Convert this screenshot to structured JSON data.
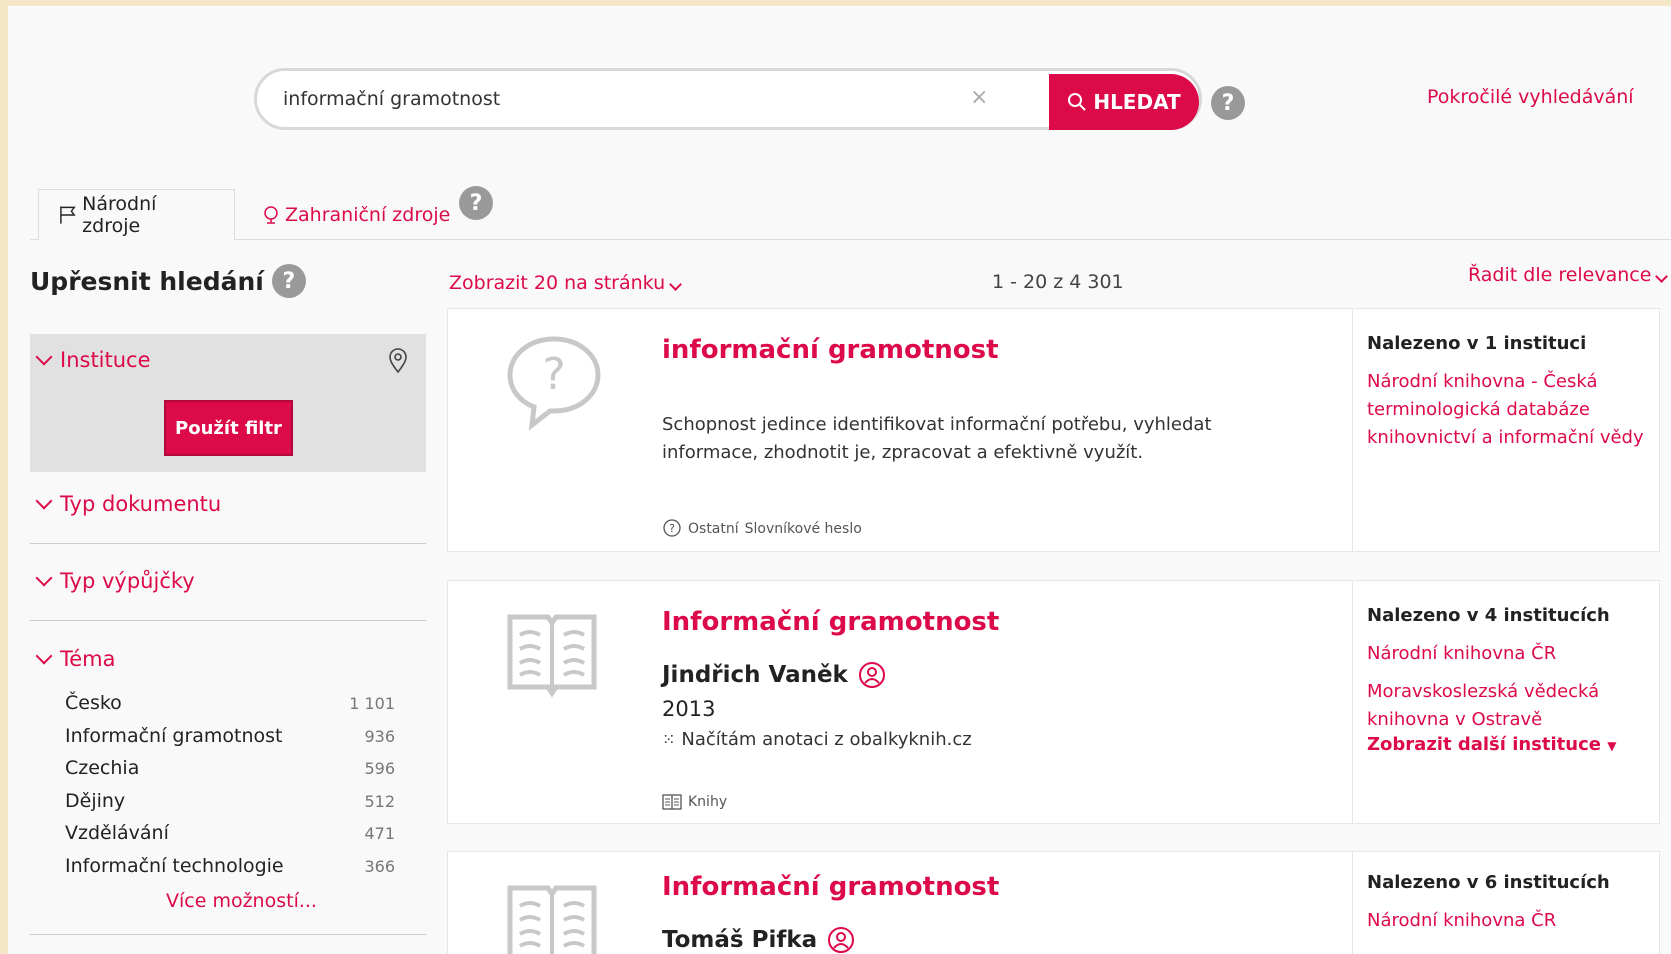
{
  "search": {
    "value": "informační gramotnost",
    "button_label": "HLEDAT",
    "clear_label": "×",
    "help": "?",
    "advanced_label": "Pokročilé vyhledávání"
  },
  "tabs": {
    "national": "Národní zdroje",
    "foreign": "Zahraniční zdroje",
    "help": "?"
  },
  "sidebar": {
    "title": "Upřesnit hledání",
    "help": "?",
    "facets": {
      "institution": "Instituce",
      "apply_button": "Použít filtr",
      "doc_type": "Typ dokumentu",
      "loan_type": "Typ výpůjčky",
      "topic": "Téma"
    },
    "topics": [
      {
        "label": "Česko",
        "count": "1 101"
      },
      {
        "label": "Informační gramotnost",
        "count": "936"
      },
      {
        "label": "Czechia",
        "count": "596"
      },
      {
        "label": "Dějiny",
        "count": "512"
      },
      {
        "label": "Vzdělávání",
        "count": "471"
      },
      {
        "label": "Informační technologie",
        "count": "366"
      }
    ],
    "more_label": "Více možností..."
  },
  "results_header": {
    "perpage": "Zobrazit 20 na stránku",
    "range": "1 - 20 z 4 301",
    "sort": "Řadit dle relevance"
  },
  "results": [
    {
      "title": "informační gramotnost",
      "description": "Schopnost jedince identifikovat informační potřebu, vyhledat informace, zhodnotit je, zpracovat a efektivně využít.",
      "meta_type": "Ostatní",
      "meta_subtype": "Slovníkové heslo",
      "found_in": "Nalezeno v 1 instituci",
      "institutions": [
        "Národní knihovna - Česká terminologická databáze knihovnictví a informační vědy"
      ]
    },
    {
      "title": "Informační gramotnost",
      "author": "Jindřich Vaněk",
      "year": "2013",
      "annotation": "Načítám anotaci z obalkyknih.cz",
      "meta_type": "Knihy",
      "found_in": "Nalezeno v 4 institucích",
      "institutions": [
        "Národní knihovna ČR",
        "Moravskoslezská vědecká knihovna v Ostravě"
      ],
      "more_label": "Zobrazit další instituce"
    },
    {
      "title": "Informační gramotnost",
      "author": "Tomáš Pifka",
      "found_in": "Nalezeno v 6 institucích",
      "institutions": [
        "Národní knihovna ČR"
      ]
    }
  ],
  "colors": {
    "accent": "#dd0a4a",
    "frame": "#f3e7c8"
  }
}
